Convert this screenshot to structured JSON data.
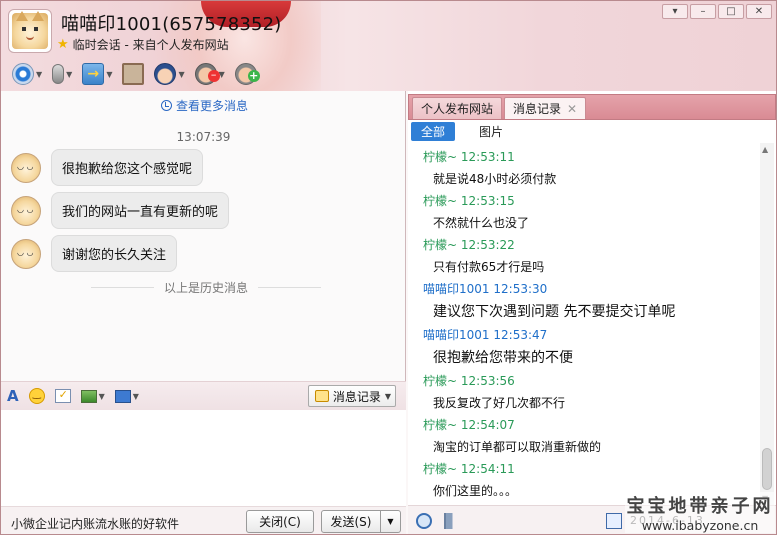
{
  "window": {
    "contact_name": "喵喵印1001(657578352)",
    "session_info": "临时会话 - 来自个人发布网站",
    "buttons": {
      "menu": "▾",
      "minimize": "–",
      "maximize": "□",
      "close": "✕"
    }
  },
  "toolbar": {
    "items": [
      {
        "name": "video",
        "icon": "camera-icon"
      },
      {
        "name": "voice",
        "icon": "microphone-icon"
      },
      {
        "name": "file",
        "icon": "send-file-icon"
      },
      {
        "name": "screen",
        "icon": "remote-screen-icon"
      },
      {
        "name": "report",
        "icon": "police-icon"
      },
      {
        "name": "block",
        "icon": "block-user-icon"
      },
      {
        "name": "add",
        "icon": "add-friend-icon"
      }
    ]
  },
  "chat": {
    "more_link": "查看更多消息",
    "time": "13:07:39",
    "messages": [
      "很抱歉给您这个感觉呢",
      "我们的网站一直有更新的呢",
      "谢谢您的长久关注"
    ],
    "history_separator": "以上是历史消息"
  },
  "format_bar": {
    "font_label": "A",
    "history_button": "消息记录"
  },
  "bottom": {
    "ad_text": "小微企业记内账流水账的好软件",
    "close_button": "关闭(C)",
    "send_button": "发送(S)"
  },
  "right_panel": {
    "tabs": [
      "个人发布网站",
      "消息记录"
    ],
    "filters": [
      "全部",
      "图片"
    ],
    "log": [
      {
        "sender": "柠檬~",
        "time": "12:53:11",
        "text": "就是说48小时必须付款",
        "self": false,
        "size": "small"
      },
      {
        "sender": "柠檬~",
        "time": "12:53:15",
        "text": "不然就什么也没了",
        "self": false,
        "size": "small"
      },
      {
        "sender": "柠檬~",
        "time": "12:53:22",
        "text": "只有付款65才行是吗",
        "self": false,
        "size": "small"
      },
      {
        "sender": "喵喵印1001",
        "time": "12:53:30",
        "text": "建议您下次遇到问题 先不要提交订单呢",
        "self": true,
        "size": "big"
      },
      {
        "sender": "喵喵印1001",
        "time": "12:53:47",
        "text": "很抱歉给您带来的不便",
        "self": true,
        "size": "big"
      },
      {
        "sender": "柠檬~",
        "time": "12:53:56",
        "text": "我反复改了好几次都不行",
        "self": false,
        "size": "small"
      },
      {
        "sender": "柠檬~",
        "time": "12:54:07",
        "text": "淘宝的订单都可以取消重新做的",
        "self": false,
        "size": "small"
      },
      {
        "sender": "柠檬~",
        "time": "12:54:11",
        "text": "你们这里的。。。",
        "self": false,
        "size": "small"
      }
    ],
    "date_partial": "2014-6-13"
  },
  "watermark": {
    "title": "宝宝地带亲子网",
    "url": "www.ibabyzone.cn"
  },
  "colors": {
    "accent": "#2f7fd6",
    "other_sender": "#2a9a58",
    "self_sender": "#1f6fc9",
    "theme_pink": "#d98b94"
  }
}
